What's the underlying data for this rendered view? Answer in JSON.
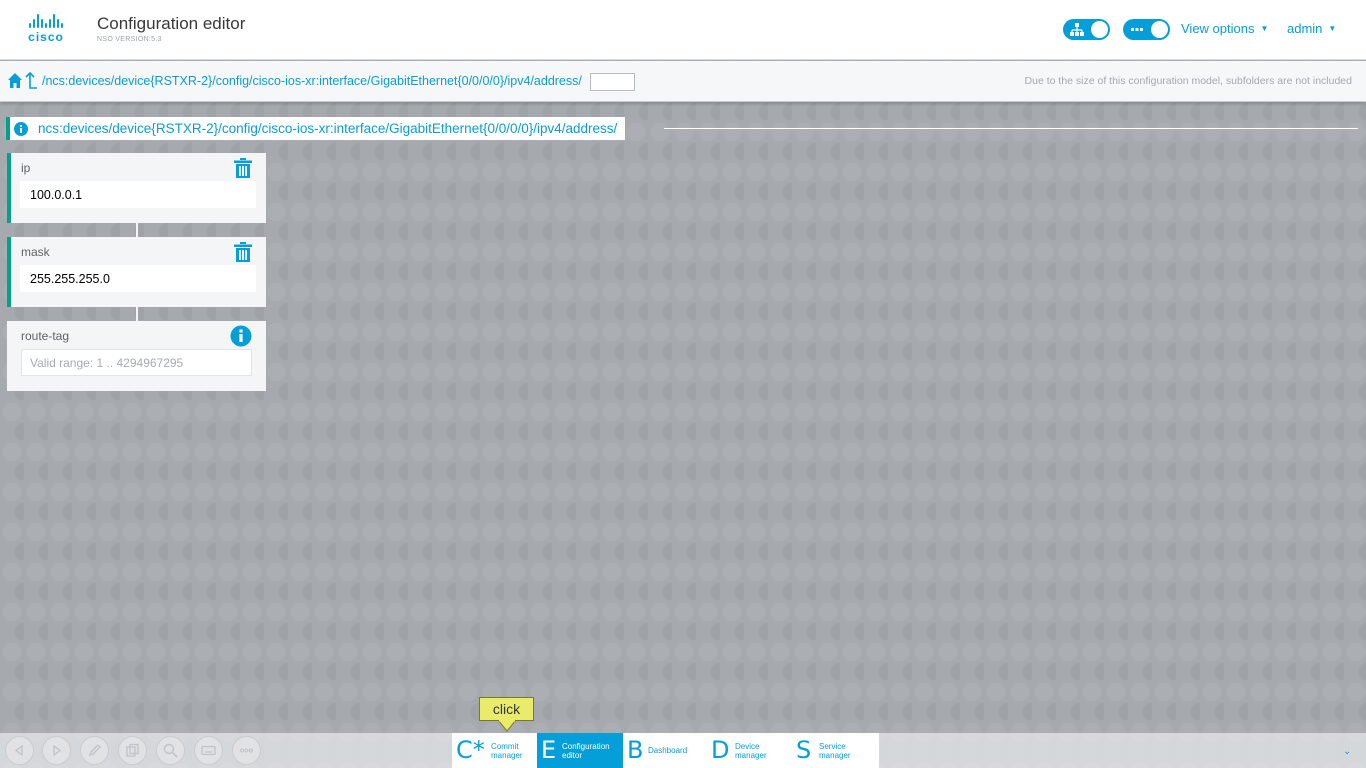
{
  "header": {
    "logo_text": "cisco",
    "title": "Configuration editor",
    "version": "NSO VERSION:5.3",
    "view_options_label": "View options",
    "user_label": "admin"
  },
  "pathbar": {
    "path": "/ncs:devices/device{RSTXR-2}/config/cisco-ios-xr:interface/GigabitEthernet{0/0/0/0}/ipv4/address/",
    "input_value": "",
    "note": "Due to the size of this configuration model, subfolders are not included"
  },
  "breadcrumb": {
    "text": "ncs:devices/device{RSTXR-2}/config/cisco-ios-xr:interface/GigabitEthernet{0/0/0/0}/ipv4/address/"
  },
  "leaves": {
    "ip": {
      "label": "ip",
      "value": "100.0.0.1"
    },
    "mask": {
      "label": "mask",
      "value": "255.255.255.0"
    },
    "route_tag": {
      "label": "route-tag",
      "value": "",
      "placeholder": "Valid range: 1 .. 4294967295"
    }
  },
  "bottombar": {
    "tabs": [
      {
        "letter": "C*",
        "line1": "Commit",
        "line2": "manager"
      },
      {
        "letter": "E",
        "line1": "Configuration",
        "line2": "editor"
      },
      {
        "letter": "B",
        "line1": "Dashboard",
        "line2": ""
      },
      {
        "letter": "D",
        "line1": "Device",
        "line2": "manager"
      },
      {
        "letter": "S",
        "line1": "Service",
        "line2": "manager"
      }
    ],
    "active_tab": "Configuration editor"
  },
  "callout": {
    "text": "click"
  },
  "colors": {
    "accent": "#049fd9",
    "teal": "#00a38a",
    "callout": "#e9ec6a"
  },
  "icons": [
    "home-icon",
    "up-arrow-icon",
    "info-icon",
    "trash-icon",
    "hierarchy-icon",
    "dots-icon",
    "back-icon",
    "forward-icon",
    "pencil-icon",
    "copy-icon",
    "zoom-icon",
    "keyboard-icon",
    "more-icon"
  ]
}
